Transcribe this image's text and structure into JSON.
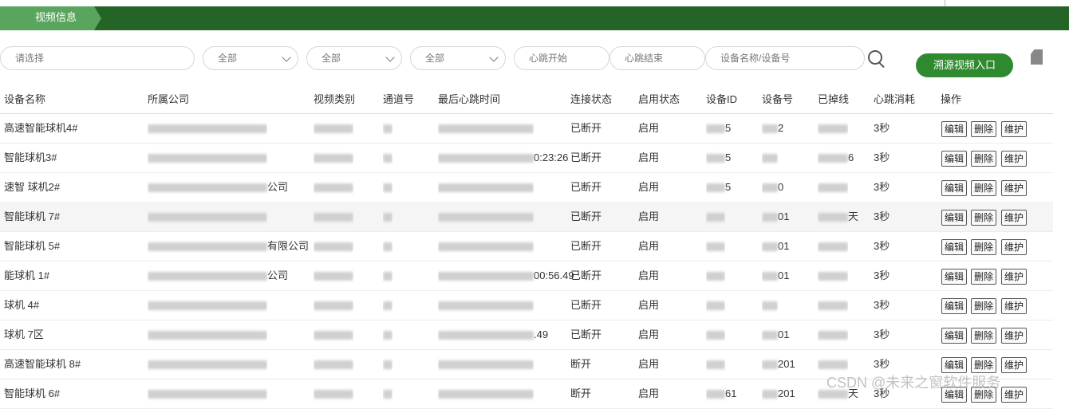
{
  "header": {
    "tab": "视频信息"
  },
  "filters": {
    "select_placeholder": "请选择",
    "sel1": "全部",
    "sel2": "全部",
    "sel3": "全部",
    "hb_start": "心跳开始",
    "hb_end": "心跳结束",
    "name_or_no": "设备名称/设备号"
  },
  "trace_button": "溯源视频入口",
  "columns": [
    "设备名称",
    "所属公司",
    "视频类别",
    "通道号",
    "最后心跳时间",
    "连接状态",
    "启用状态",
    "设备ID",
    "设备号",
    "已掉线",
    "心跳消耗",
    "操作"
  ],
  "ops": {
    "edit": "编辑",
    "delete": "删除",
    "maintain": "维护"
  },
  "rows": [
    {
      "name": "高速智能球机4#",
      "company": "",
      "type": "",
      "channel": "",
      "last_hb": "",
      "conn": "已断开",
      "enable": "启用",
      "dev_id": "5",
      "dev_no": "2",
      "offline": "",
      "hb_cost": "3秒"
    },
    {
      "name": "智能球机3#",
      "company": "",
      "type": "",
      "channel": "",
      "last_hb": "0:23:26",
      "conn": "已断开",
      "enable": "启用",
      "dev_id": "5",
      "dev_no": "",
      "offline": "6",
      "hb_cost": "3秒"
    },
    {
      "name": "速智 球机2#",
      "company": "公司",
      "type": "",
      "channel": "",
      "last_hb": "",
      "conn": "已断开",
      "enable": "启用",
      "dev_id": "5",
      "dev_no": "0",
      "offline": "",
      "hb_cost": "3秒"
    },
    {
      "name": "智能球机 7#",
      "company": "",
      "type": "",
      "channel": "",
      "last_hb": "",
      "conn": "已断开",
      "enable": "启用",
      "dev_id": "",
      "dev_no": "01",
      "offline": "天",
      "hb_cost": "3秒"
    },
    {
      "name": "智能球机 5#",
      "company": "有限公司",
      "type": "",
      "channel": "",
      "last_hb": "",
      "conn": "已断开",
      "enable": "启用",
      "dev_id": "",
      "dev_no": "01",
      "offline": "",
      "hb_cost": "3秒"
    },
    {
      "name": "能球机 1#",
      "company": "公司",
      "type": "",
      "channel": "",
      "last_hb": "00:56.49",
      "conn": "已断开",
      "enable": "启用",
      "dev_id": "",
      "dev_no": "01",
      "offline": "",
      "hb_cost": "3秒"
    },
    {
      "name": "球机 4#",
      "company": "",
      "type": "",
      "channel": "",
      "last_hb": "",
      "conn": "已断开",
      "enable": "启用",
      "dev_id": "",
      "dev_no": "",
      "offline": "",
      "hb_cost": "3秒"
    },
    {
      "name": "球机 7区",
      "company": "",
      "type": "",
      "channel": "",
      "last_hb": ".49",
      "conn": "已断开",
      "enable": "启用",
      "dev_id": "",
      "dev_no": "01",
      "offline": "",
      "hb_cost": "3秒"
    },
    {
      "name": "高速智能球机 8#",
      "company": "",
      "type": "",
      "channel": "",
      "last_hb": "",
      "conn": "断开",
      "enable": "启用",
      "dev_id": "",
      "dev_no": "201",
      "offline": "",
      "hb_cost": "3秒"
    },
    {
      "name": "智能球机 6#",
      "company": "",
      "type": "",
      "channel": "",
      "last_hb": "",
      "conn": "断开",
      "enable": "启用",
      "dev_id": "61",
      "dev_no": "201",
      "offline": "天",
      "hb_cost": "3秒"
    }
  ],
  "watermark": "CSDN @未来之窗软件服务"
}
